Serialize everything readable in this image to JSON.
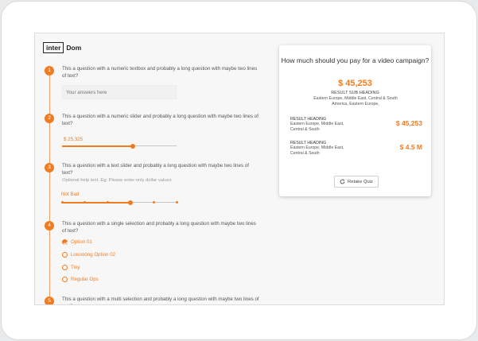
{
  "brand": {
    "logo_box": "inter",
    "logo_plain": "Dom"
  },
  "questions": [
    {
      "number": "1",
      "text": "This a question with a numeric textbox and probably a long question with maybe two lines of text?",
      "placeholder": "Your answers here"
    },
    {
      "number": "2",
      "text": "This a question with a numeric slider and probably a long question with maybe two lines of text?",
      "slider_value": "$ 25,325",
      "slider_fraction": 0.62
    },
    {
      "number": "3",
      "text": "This a question with a text slider and probably a long question with maybe two lines of text?",
      "help": "Optional help text. Eg: Please enter only dollar values",
      "slider_value": "Not Bad",
      "steps": 6,
      "selected_step": 3
    },
    {
      "number": "4",
      "text": "This a question with a single selection and probably a long question with maybe two lines of text?",
      "options": [
        "Option 01",
        "Looooong Option 02",
        "Tiny",
        "Regular Ops"
      ],
      "selected_index": 0
    },
    {
      "number": "5",
      "text": "This a question with a multi selection and probably a long question with maybe two lines of text?"
    }
  ],
  "result_card": {
    "title": "How much should you pay for a video campaign?",
    "value": "$ 45,253",
    "sub_heading": "RESULT SUB HEADING",
    "sub_desc": "Eastern Europe, Middle East, Central & South America, Eastern Europe,",
    "results": [
      {
        "heading": "RESULT HEADING",
        "desc": "Eastern Europe, Middle East, Central & South",
        "value": "$ 45,253"
      },
      {
        "heading": "RESULT HEADING",
        "desc": "Eastern Europe, Middle East, Central & South",
        "value": "$ 4.5 M"
      }
    ],
    "retake_label": "Retake Quiz"
  },
  "colors": {
    "accent": "#f07c22",
    "background": "#f7f7f7"
  }
}
